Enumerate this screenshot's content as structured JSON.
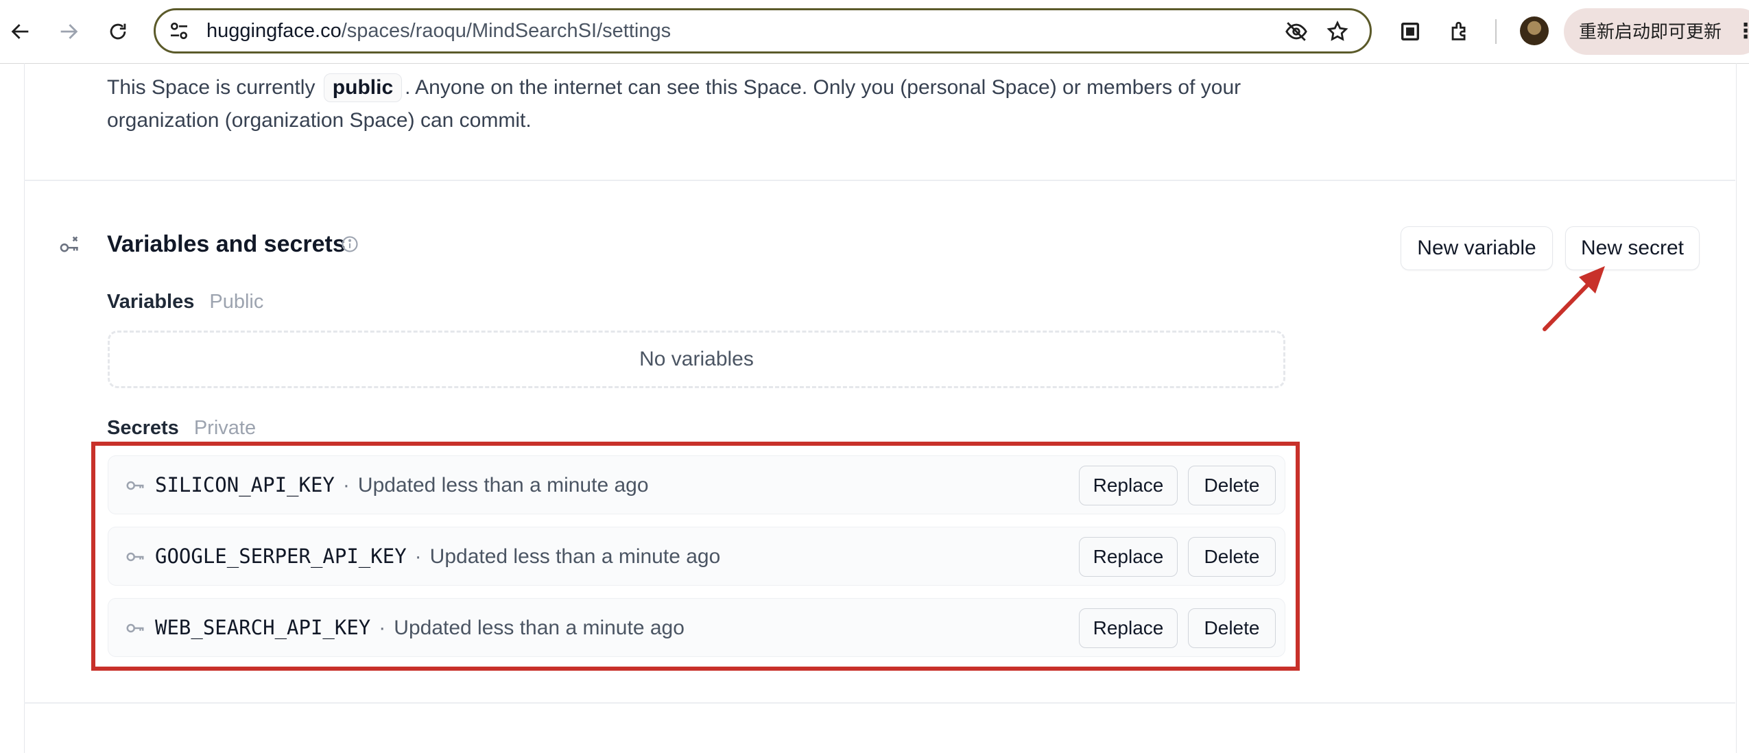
{
  "browser": {
    "url_host": "huggingface.co",
    "url_path": "/spaces/raoqu/MindSearchSI/settings",
    "update_button": "重新启动即可更新",
    "icons": [
      "back-arrow-icon",
      "forward-arrow-icon",
      "reload-icon",
      "site-settings-icon",
      "eye-off-icon",
      "star-icon",
      "qr-code-icon",
      "extensions-icon",
      "profile-avatar",
      "more-vert-icon"
    ]
  },
  "visibility": {
    "text_before": "This Space is currently",
    "chip": "public",
    "text_after": ". Anyone on the internet can see this Space. Only you (personal Space) or members of your organization (organization Space) can commit."
  },
  "variables_section": {
    "title": "Variables and secrets",
    "new_variable_button": "New variable",
    "new_secret_button": "New secret",
    "variables_label": "Variables",
    "variables_scope": "Public",
    "variables_empty": "No variables",
    "secrets_label": "Secrets",
    "secrets_scope": "Private",
    "secrets": [
      {
        "name": "SILICON_API_KEY",
        "updated": "Updated less than a minute ago",
        "replace": "Replace",
        "delete": "Delete"
      },
      {
        "name": "GOOGLE_SERPER_API_KEY",
        "updated": "Updated less than a minute ago",
        "replace": "Replace",
        "delete": "Delete"
      },
      {
        "name": "WEB_SEARCH_API_KEY",
        "updated": "Updated less than a minute ago",
        "replace": "Replace",
        "delete": "Delete"
      }
    ]
  },
  "annotations": {
    "highlight_color": "#c8312a"
  }
}
